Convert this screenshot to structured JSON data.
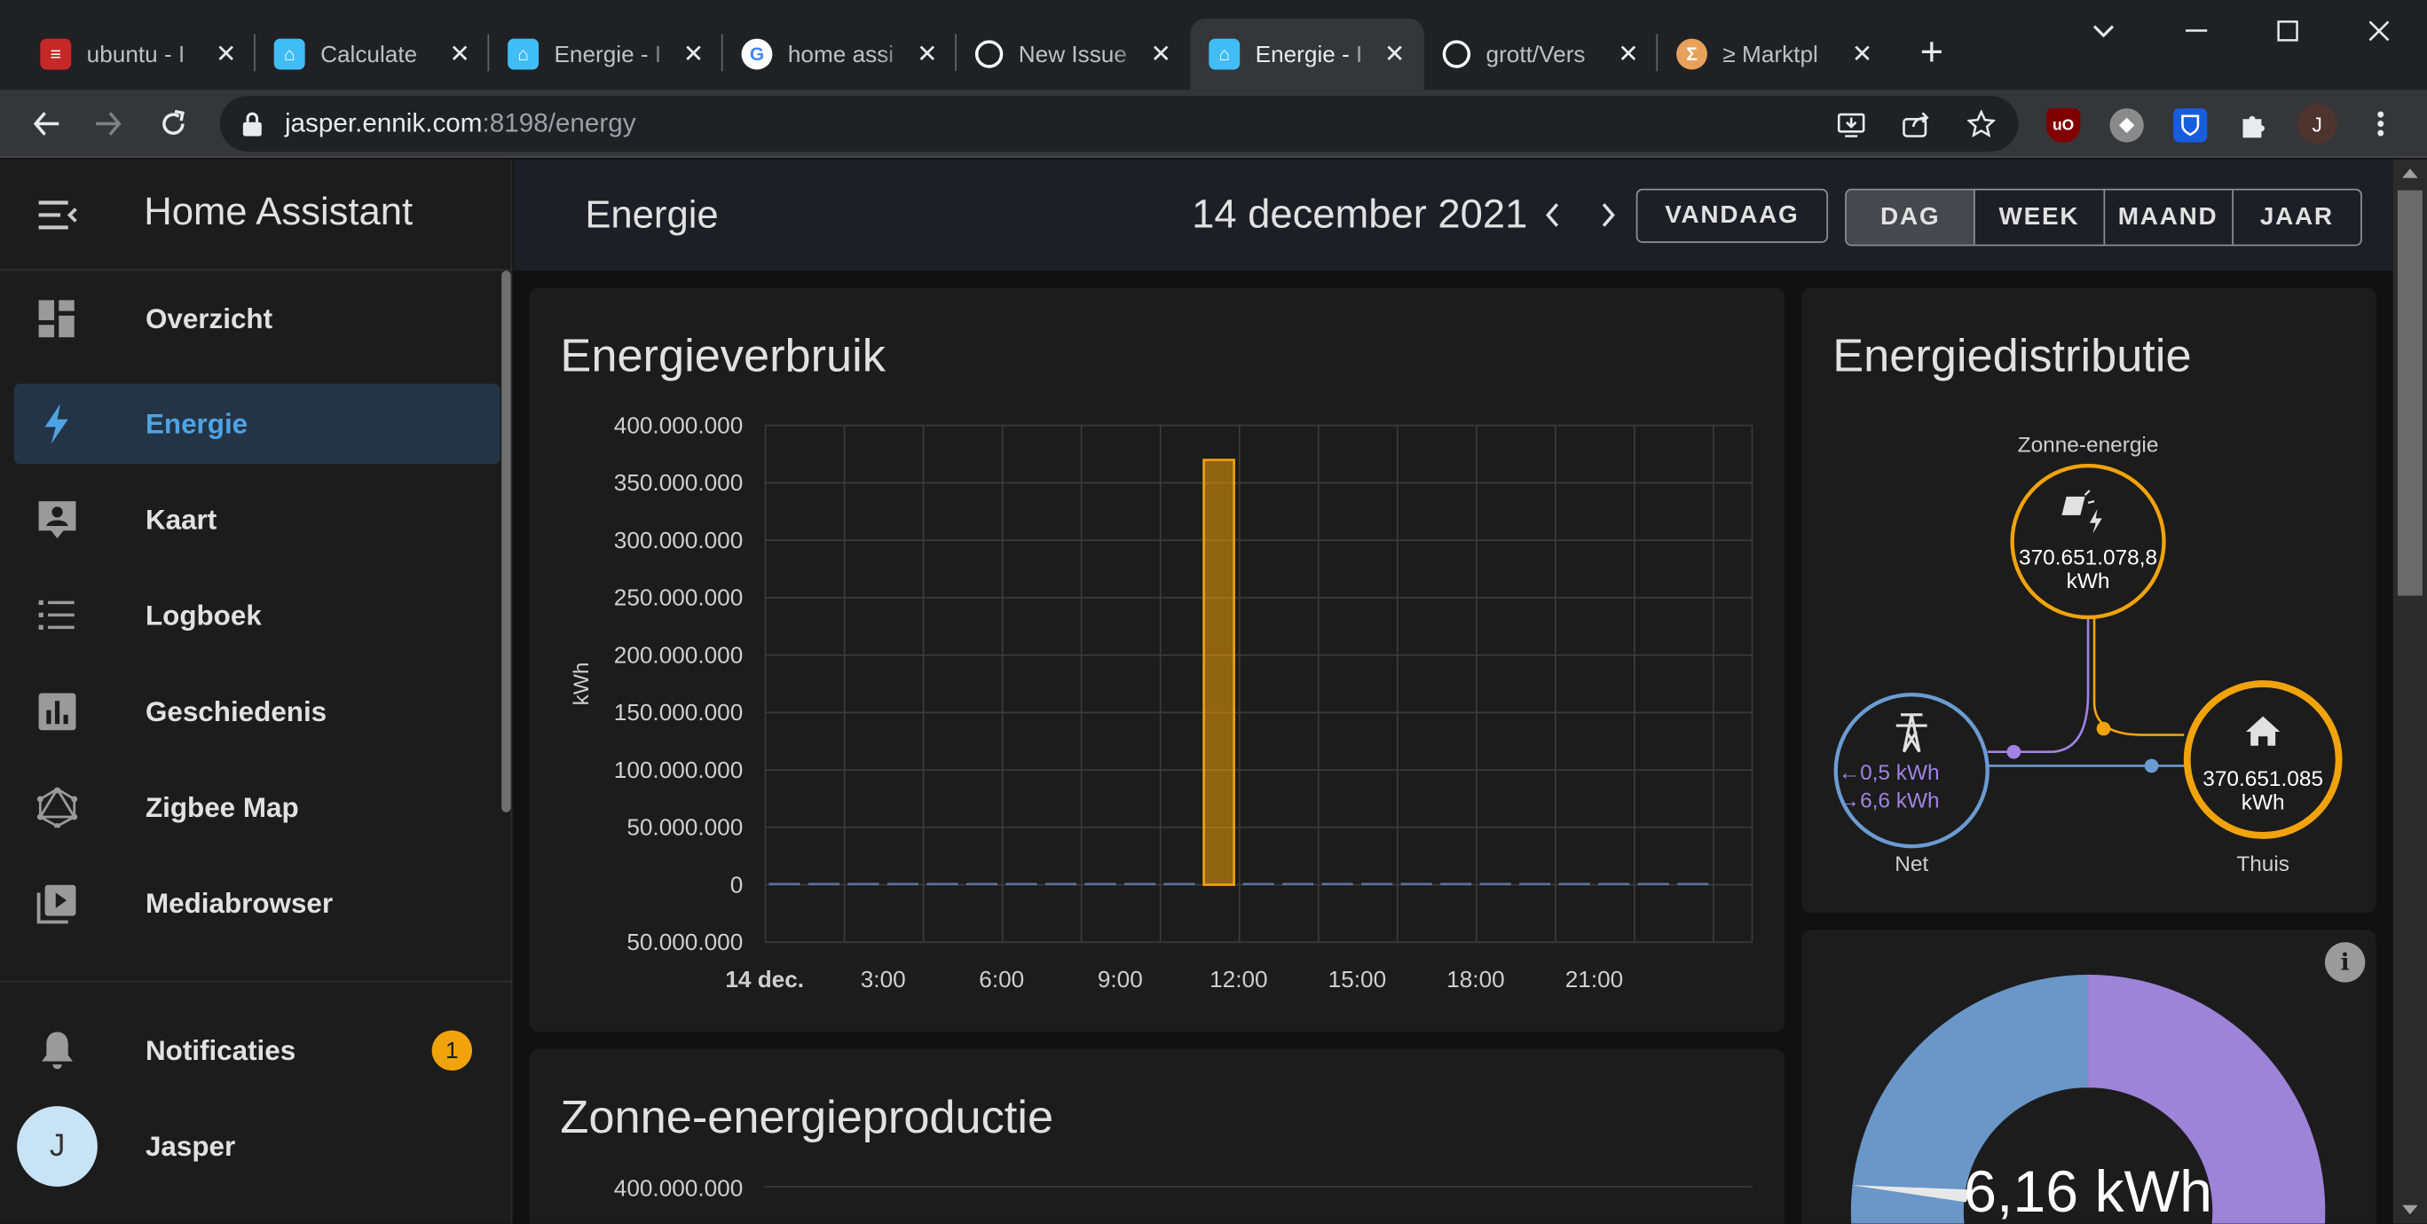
{
  "browser": {
    "tabs": [
      {
        "title": "ubuntu - I",
        "favicon": "server-rack-icon",
        "active": false
      },
      {
        "title": "Calculate",
        "favicon": "home-assistant-icon",
        "active": false
      },
      {
        "title": "Energie - I",
        "favicon": "home-assistant-icon",
        "active": false
      },
      {
        "title": "home assi",
        "favicon": "google-icon",
        "active": false
      },
      {
        "title": "New Issue",
        "favicon": "github-icon",
        "active": false
      },
      {
        "title": "Energie - I",
        "favicon": "home-assistant-icon",
        "active": true
      },
      {
        "title": "grott/Vers",
        "favicon": "github-icon",
        "active": false
      },
      {
        "title": "≥ Marktpl",
        "favicon": "marktplaats-icon",
        "active": false
      }
    ],
    "url_host": "jasper.ennik.com",
    "url_path": ":8198/energy",
    "profile_initial": "J",
    "extensions": [
      "uBlock",
      "ext",
      "Bitwarden"
    ]
  },
  "sidebar": {
    "app_title": "Home Assistant",
    "items": [
      {
        "label": "Overzicht",
        "icon": "dashboard-icon",
        "active": false
      },
      {
        "label": "Energie",
        "icon": "lightning-bolt-icon",
        "active": true
      },
      {
        "label": "Kaart",
        "icon": "map-account-icon",
        "active": false
      },
      {
        "label": "Logboek",
        "icon": "logbook-list-icon",
        "active": false
      },
      {
        "label": "Geschiedenis",
        "icon": "chart-box-icon",
        "active": false
      },
      {
        "label": "Zigbee Map",
        "icon": "graphql-icon",
        "active": false
      },
      {
        "label": "Mediabrowser",
        "icon": "play-box-multiple-icon",
        "active": false
      }
    ],
    "notifications": {
      "label": "Notificaties",
      "count": "1"
    },
    "user": {
      "name": "Jasper",
      "initial": "J"
    }
  },
  "header": {
    "page_title": "Energie",
    "date": "14 december 2021",
    "today_label": "VANDAAG",
    "periods": [
      {
        "label": "DAG",
        "selected": true
      },
      {
        "label": "WEEK",
        "selected": false
      },
      {
        "label": "MAAND",
        "selected": false
      },
      {
        "label": "JAAR",
        "selected": false
      }
    ]
  },
  "usage_card": {
    "title": "Energieverbruik",
    "ylabel": "kWh",
    "y_ticks": [
      "400.000.000",
      "350.000.000",
      "300.000.000",
      "250.000.000",
      "200.000.000",
      "150.000.000",
      "100.000.000",
      "50.000.000",
      "0",
      "50.000.000"
    ],
    "x_ticks": [
      "14 dec.",
      "3:00",
      "6:00",
      "9:00",
      "12:00",
      "15:00",
      "18:00",
      "21:00"
    ]
  },
  "solar_card": {
    "title": "Zonne-energieproductie",
    "first_tick": "400.000.000"
  },
  "distribution_card": {
    "title": "Energiedistributie",
    "solar": {
      "label": "Zonne-energie",
      "value": "370.651.078,8",
      "unit": "kWh"
    },
    "grid": {
      "label": "Net",
      "from_grid": "0,5 kWh",
      "to_grid": "6,6 kWh"
    },
    "home": {
      "label": "Thuis",
      "value": "370.651.085",
      "unit": "kWh"
    }
  },
  "gauge_card": {
    "value": "6,16 kWh",
    "info_icon": "information-icon",
    "colors": {
      "left": "#6b96c8",
      "right": "#9d84d9"
    }
  },
  "colors": {
    "accent_blue": "#4fa3e3",
    "solar_orange": "#f0a30a",
    "grid_blue": "#6c9bd2",
    "grid_purple": "#a083e4"
  },
  "chart_data": {
    "type": "bar",
    "title": "Energieverbruik",
    "ylabel": "kWh",
    "ylim": [
      -50000000,
      400000000
    ],
    "x": [
      "0:00",
      "1:00",
      "2:00",
      "3:00",
      "4:00",
      "5:00",
      "6:00",
      "7:00",
      "8:00",
      "9:00",
      "10:00",
      "11:00",
      "12:00",
      "13:00",
      "14:00",
      "15:00",
      "16:00",
      "17:00",
      "18:00",
      "19:00",
      "20:00",
      "21:00",
      "22:00",
      "23:00"
    ],
    "series": [
      {
        "values": [
          0,
          0,
          0,
          0,
          0,
          0,
          0,
          0,
          0,
          0,
          0,
          370000000,
          0,
          0,
          0,
          0,
          0,
          0,
          0,
          0,
          0,
          0,
          0,
          0
        ],
        "color": "#f0a30a"
      }
    ],
    "grid": true
  }
}
